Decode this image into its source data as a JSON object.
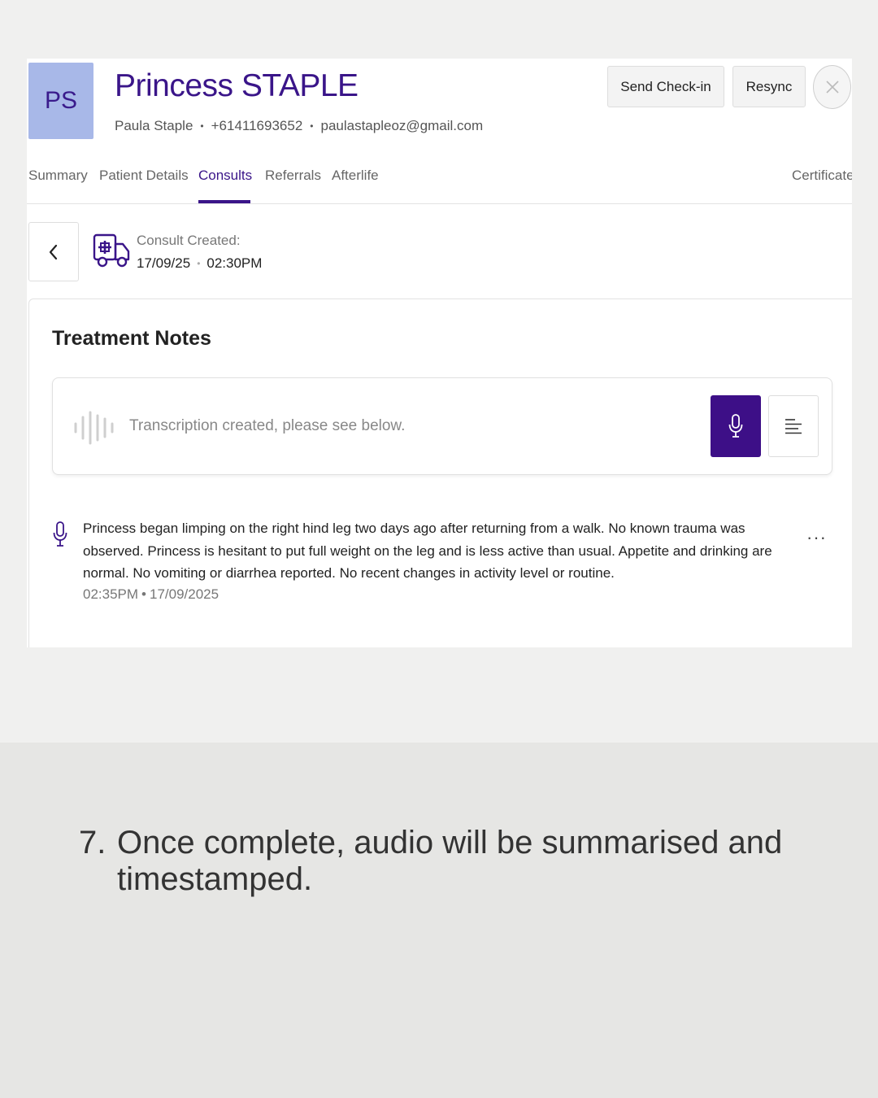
{
  "patient": {
    "initials": "PS",
    "name": "Princess STAPLE",
    "owner": "Paula Staple",
    "phone": "+61411693652",
    "email": "paulastapleoz@gmail.com",
    "separator": "•"
  },
  "header": {
    "send_checkin_label": "Send Check-in",
    "resync_label": "Resync"
  },
  "tabs": [
    {
      "label": "Summary"
    },
    {
      "label": "Patient Details"
    },
    {
      "label": "Consults"
    },
    {
      "label": "Referrals"
    },
    {
      "label": "Afterlife"
    },
    {
      "label": "Certificate"
    }
  ],
  "active_tab": "Consults",
  "consult": {
    "created_label": "Consult Created:",
    "date": "17/09/25",
    "time": "02:30PM",
    "separator": "•"
  },
  "treatment_notes": {
    "title": "Treatment Notes",
    "transcription_status": "Transcription created, please see below.",
    "entry": {
      "text": "Princess began limping on the right hind leg two days ago after returning from a walk. No known trauma was observed. Princess is hesitant to put full weight on the leg and is less active than usual. Appetite and drinking are normal. No vomiting or diarrhea reported. No recent changes in activity level or routine.",
      "time": "02:35PM",
      "date": "17/09/2025",
      "separator": "•",
      "more_label": "···"
    }
  },
  "caption": {
    "number": "7.",
    "text": "Once complete, audio will be summarised and timestamped."
  },
  "colors": {
    "accent": "#3a1589",
    "mic_button": "#3d0f87",
    "avatar_bg": "#a8b8e8",
    "page_bg": "#f0f0ef",
    "caption_bg": "#e6e6e4"
  },
  "icons": {
    "close": "close-icon",
    "back": "chevron-left-icon",
    "consult": "ambulance-icon",
    "waveform": "waveform-icon",
    "mic": "microphone-icon",
    "menu": "text-align-icon",
    "more": "more-horizontal-icon"
  }
}
